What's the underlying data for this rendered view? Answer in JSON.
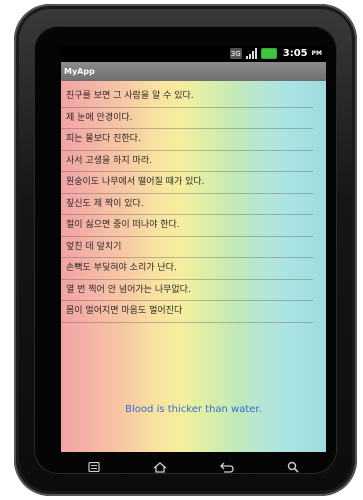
{
  "status_bar": {
    "network_label": "3G",
    "time": "3:05",
    "ampm": "PM",
    "icons": [
      "network-3g-icon",
      "signal-icon",
      "battery-icon"
    ],
    "battery_color": "#3ec43e"
  },
  "app": {
    "title": "MyApp"
  },
  "proverbs": [
    {
      "text": "친구를 보면 그 사람을 알 수 있다."
    },
    {
      "text": "제 눈에 안경이다."
    },
    {
      "text": "피는 물보다 진한다."
    },
    {
      "text": "사서 고생을 하지 마라."
    },
    {
      "text": "원숭이도 나무에서 떨어질 때가 있다."
    },
    {
      "text": "짚신도 제 짝이 있다."
    },
    {
      "text": "절이 싫으면 중이 떠나야 한다."
    },
    {
      "text": "엎친 데 덮치기"
    },
    {
      "text": "손뼉도 부딪혀야 소리가 난다."
    },
    {
      "text": "열 번 찍어 안 넘어가는 나무없다."
    },
    {
      "text": "몸이 멀어지면 마음도 멀어진다"
    }
  ],
  "translation": {
    "text": "Blood is thicker than water.",
    "color": "#2f6fd1"
  },
  "nav_buttons": [
    "menu-icon",
    "home-icon",
    "back-icon",
    "search-icon"
  ]
}
